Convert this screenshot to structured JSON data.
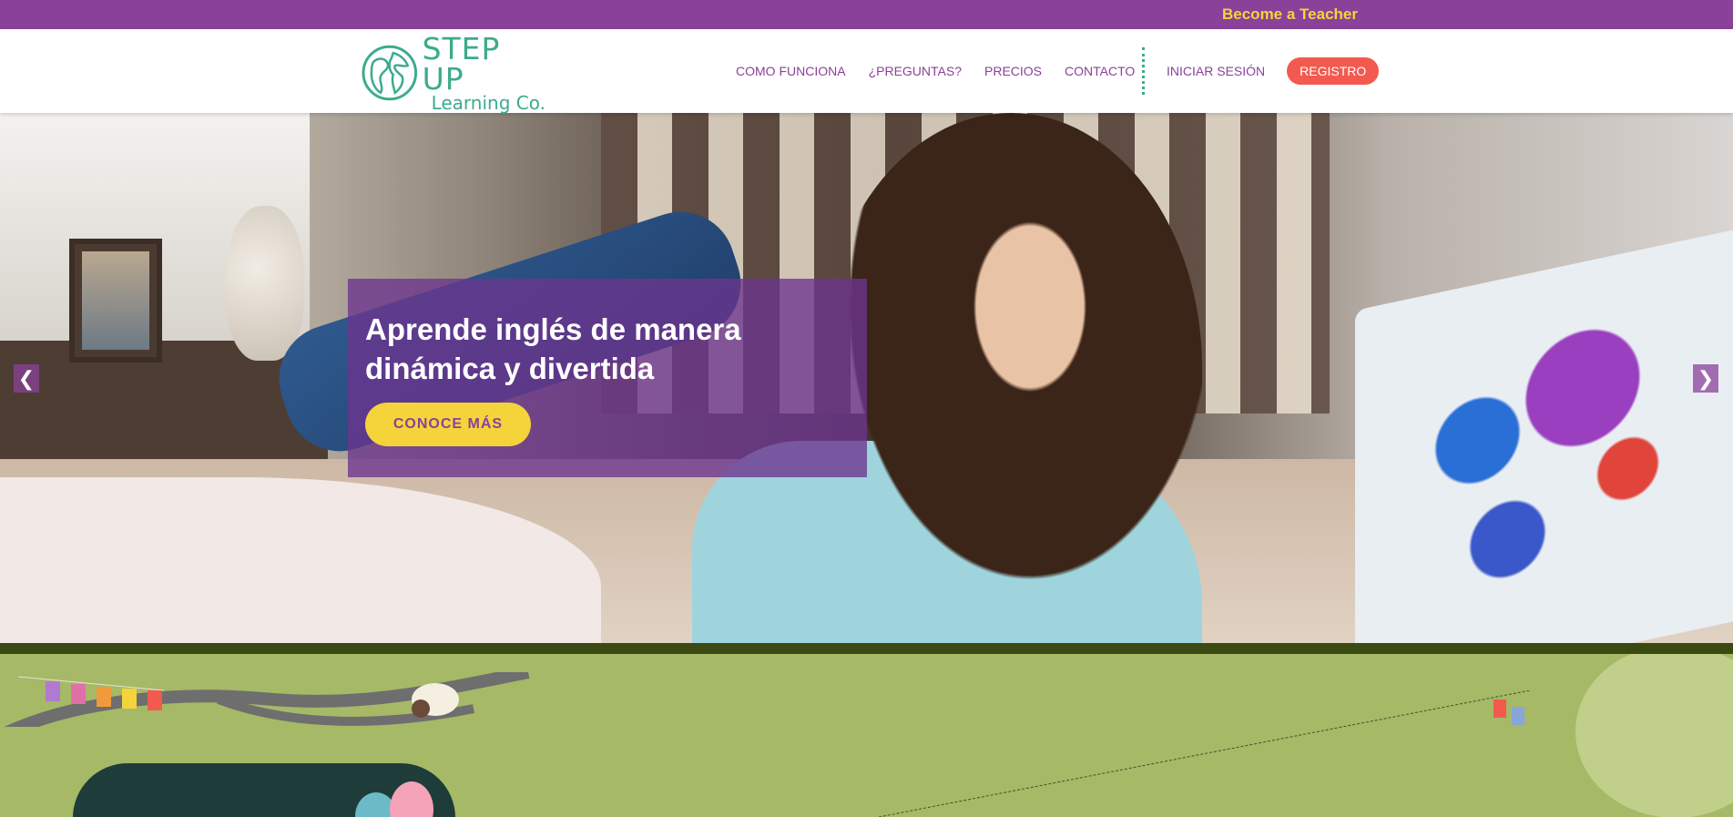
{
  "topbar": {
    "link": "Become a Teacher",
    "background": "#8a4199",
    "link_color": "#f5d33b"
  },
  "brand": {
    "line1": "STEP UP",
    "line2": "Learning Co.",
    "color": "#3cab8c"
  },
  "nav": {
    "items": [
      "COMO FUNCIONA",
      "¿PREGUNTAS?",
      "PRECIOS",
      "CONTACTO"
    ],
    "login": "INICIAR SESIÓN",
    "register": "REGISTRO",
    "color": "#8a4199",
    "register_bg": "#f25a50"
  },
  "hero": {
    "title": "Aprende inglés de manera dinámica y divertida",
    "cta": "CONOCE MÁS",
    "prev": "❮",
    "next": "❯"
  }
}
